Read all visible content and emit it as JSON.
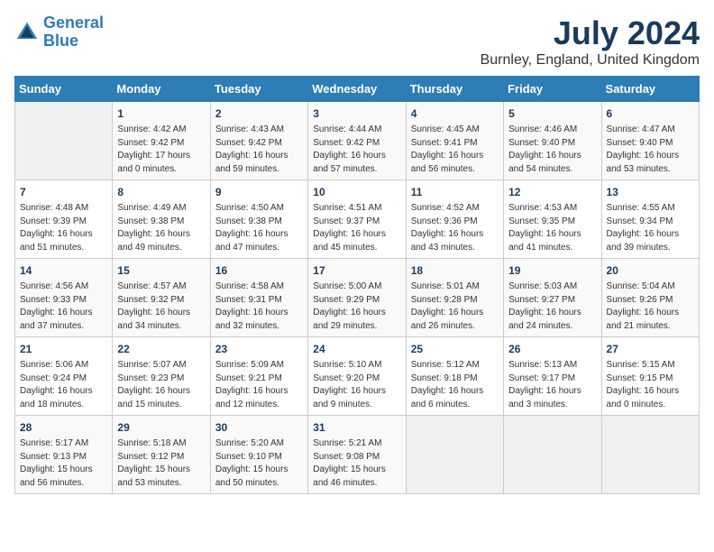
{
  "header": {
    "logo_line1": "General",
    "logo_line2": "Blue",
    "month_year": "July 2024",
    "location": "Burnley, England, United Kingdom"
  },
  "weekdays": [
    "Sunday",
    "Monday",
    "Tuesday",
    "Wednesday",
    "Thursday",
    "Friday",
    "Saturday"
  ],
  "weeks": [
    [
      {
        "day": "",
        "info": ""
      },
      {
        "day": "1",
        "info": "Sunrise: 4:42 AM\nSunset: 9:42 PM\nDaylight: 17 hours\nand 0 minutes."
      },
      {
        "day": "2",
        "info": "Sunrise: 4:43 AM\nSunset: 9:42 PM\nDaylight: 16 hours\nand 59 minutes."
      },
      {
        "day": "3",
        "info": "Sunrise: 4:44 AM\nSunset: 9:42 PM\nDaylight: 16 hours\nand 57 minutes."
      },
      {
        "day": "4",
        "info": "Sunrise: 4:45 AM\nSunset: 9:41 PM\nDaylight: 16 hours\nand 56 minutes."
      },
      {
        "day": "5",
        "info": "Sunrise: 4:46 AM\nSunset: 9:40 PM\nDaylight: 16 hours\nand 54 minutes."
      },
      {
        "day": "6",
        "info": "Sunrise: 4:47 AM\nSunset: 9:40 PM\nDaylight: 16 hours\nand 53 minutes."
      }
    ],
    [
      {
        "day": "7",
        "info": "Sunrise: 4:48 AM\nSunset: 9:39 PM\nDaylight: 16 hours\nand 51 minutes."
      },
      {
        "day": "8",
        "info": "Sunrise: 4:49 AM\nSunset: 9:38 PM\nDaylight: 16 hours\nand 49 minutes."
      },
      {
        "day": "9",
        "info": "Sunrise: 4:50 AM\nSunset: 9:38 PM\nDaylight: 16 hours\nand 47 minutes."
      },
      {
        "day": "10",
        "info": "Sunrise: 4:51 AM\nSunset: 9:37 PM\nDaylight: 16 hours\nand 45 minutes."
      },
      {
        "day": "11",
        "info": "Sunrise: 4:52 AM\nSunset: 9:36 PM\nDaylight: 16 hours\nand 43 minutes."
      },
      {
        "day": "12",
        "info": "Sunrise: 4:53 AM\nSunset: 9:35 PM\nDaylight: 16 hours\nand 41 minutes."
      },
      {
        "day": "13",
        "info": "Sunrise: 4:55 AM\nSunset: 9:34 PM\nDaylight: 16 hours\nand 39 minutes."
      }
    ],
    [
      {
        "day": "14",
        "info": "Sunrise: 4:56 AM\nSunset: 9:33 PM\nDaylight: 16 hours\nand 37 minutes."
      },
      {
        "day": "15",
        "info": "Sunrise: 4:57 AM\nSunset: 9:32 PM\nDaylight: 16 hours\nand 34 minutes."
      },
      {
        "day": "16",
        "info": "Sunrise: 4:58 AM\nSunset: 9:31 PM\nDaylight: 16 hours\nand 32 minutes."
      },
      {
        "day": "17",
        "info": "Sunrise: 5:00 AM\nSunset: 9:29 PM\nDaylight: 16 hours\nand 29 minutes."
      },
      {
        "day": "18",
        "info": "Sunrise: 5:01 AM\nSunset: 9:28 PM\nDaylight: 16 hours\nand 26 minutes."
      },
      {
        "day": "19",
        "info": "Sunrise: 5:03 AM\nSunset: 9:27 PM\nDaylight: 16 hours\nand 24 minutes."
      },
      {
        "day": "20",
        "info": "Sunrise: 5:04 AM\nSunset: 9:26 PM\nDaylight: 16 hours\nand 21 minutes."
      }
    ],
    [
      {
        "day": "21",
        "info": "Sunrise: 5:06 AM\nSunset: 9:24 PM\nDaylight: 16 hours\nand 18 minutes."
      },
      {
        "day": "22",
        "info": "Sunrise: 5:07 AM\nSunset: 9:23 PM\nDaylight: 16 hours\nand 15 minutes."
      },
      {
        "day": "23",
        "info": "Sunrise: 5:09 AM\nSunset: 9:21 PM\nDaylight: 16 hours\nand 12 minutes."
      },
      {
        "day": "24",
        "info": "Sunrise: 5:10 AM\nSunset: 9:20 PM\nDaylight: 16 hours\nand 9 minutes."
      },
      {
        "day": "25",
        "info": "Sunrise: 5:12 AM\nSunset: 9:18 PM\nDaylight: 16 hours\nand 6 minutes."
      },
      {
        "day": "26",
        "info": "Sunrise: 5:13 AM\nSunset: 9:17 PM\nDaylight: 16 hours\nand 3 minutes."
      },
      {
        "day": "27",
        "info": "Sunrise: 5:15 AM\nSunset: 9:15 PM\nDaylight: 16 hours\nand 0 minutes."
      }
    ],
    [
      {
        "day": "28",
        "info": "Sunrise: 5:17 AM\nSunset: 9:13 PM\nDaylight: 15 hours\nand 56 minutes."
      },
      {
        "day": "29",
        "info": "Sunrise: 5:18 AM\nSunset: 9:12 PM\nDaylight: 15 hours\nand 53 minutes."
      },
      {
        "day": "30",
        "info": "Sunrise: 5:20 AM\nSunset: 9:10 PM\nDaylight: 15 hours\nand 50 minutes."
      },
      {
        "day": "31",
        "info": "Sunrise: 5:21 AM\nSunset: 9:08 PM\nDaylight: 15 hours\nand 46 minutes."
      },
      {
        "day": "",
        "info": ""
      },
      {
        "day": "",
        "info": ""
      },
      {
        "day": "",
        "info": ""
      }
    ]
  ]
}
